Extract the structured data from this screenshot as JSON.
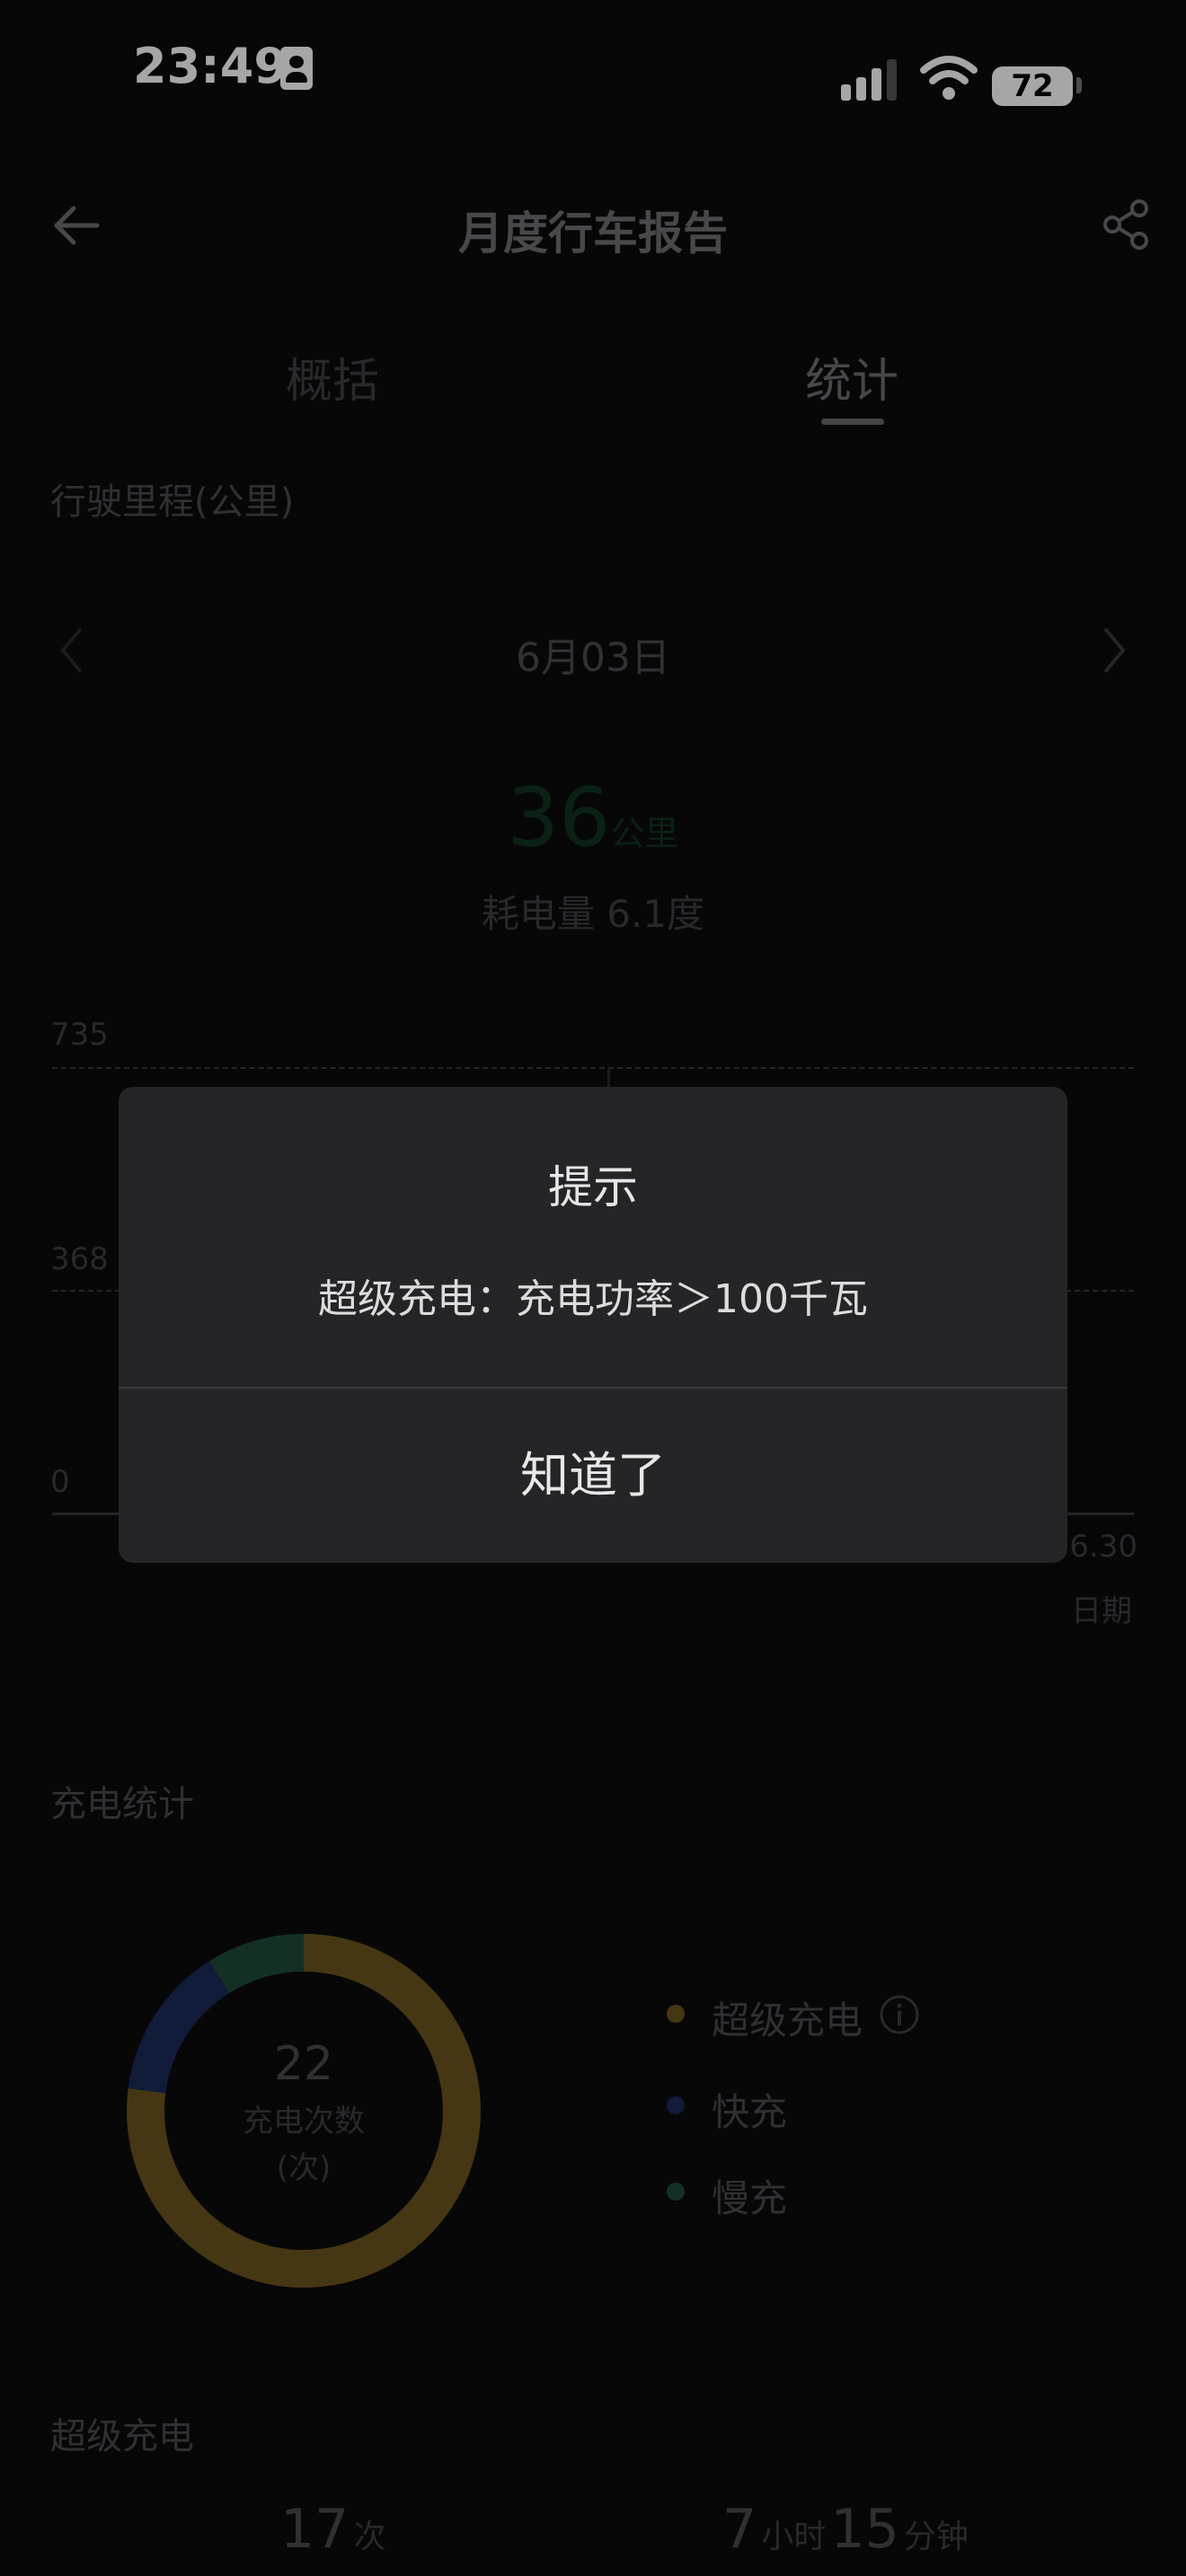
{
  "status": {
    "time": "23:49",
    "battery": "72"
  },
  "header": {
    "title": "月度行车报告"
  },
  "tabs": [
    {
      "label": "概括"
    },
    {
      "label": "统计"
    }
  ],
  "mileage": {
    "section_title": "行驶里程(公里)",
    "date": "6月03日",
    "distance_value": "36",
    "distance_unit": "公里",
    "energy_text": "耗电量 6.1度"
  },
  "chart_data": {
    "type": "bar",
    "ylim": [
      0,
      735
    ],
    "y_ticks": [
      "735",
      "368",
      "0"
    ],
    "x_tick_visible": "6.30",
    "xlabel": "日期"
  },
  "charging": {
    "section_title": "充电统计",
    "total_count": "22",
    "count_label": "充电次数",
    "count_unit": "(次)",
    "legend": [
      {
        "label": "超级充电",
        "color": "#6b5520"
      },
      {
        "label": "快充",
        "color": "#1b2a5a"
      },
      {
        "label": "慢充",
        "color": "#1f4a3a"
      }
    ],
    "donut": {
      "super_fraction": 0.77,
      "fast_fraction": 0.14,
      "slow_fraction": 0.09
    }
  },
  "super_charge": {
    "section_title": "超级充电",
    "times_value": "17",
    "times_unit": "次",
    "hours_value": "7",
    "hours_unit": "小时",
    "minutes_value": "15",
    "minutes_unit": "分钟"
  },
  "dialog": {
    "title": "提示",
    "message": "超级充电：充电功率＞100千瓦",
    "button": "知道了"
  }
}
